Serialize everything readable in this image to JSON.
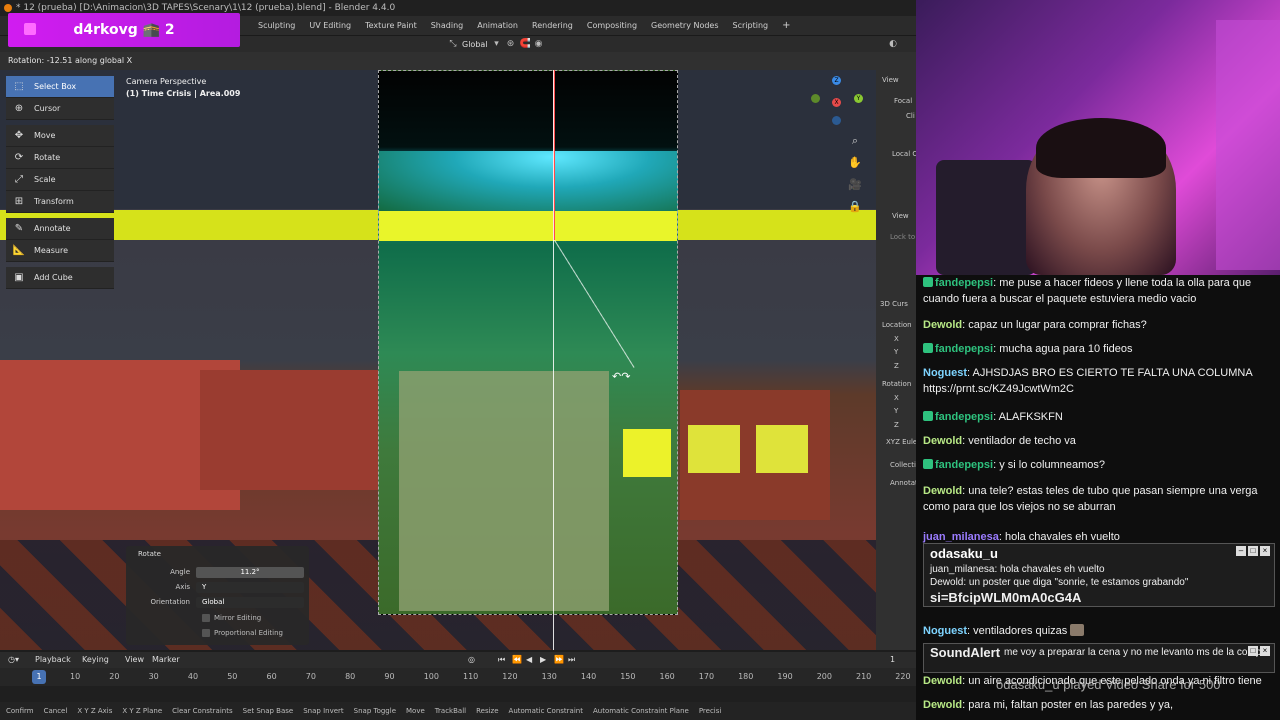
{
  "window": {
    "title": "* 12 (prueba) [D:\\Animacion\\3D TAPES\\Scenary\\1\\12 (prueba).blend] - Blender 4.4.0"
  },
  "overlay_tag": "d4rkovg 🕋 2",
  "workspaces": [
    "Sculpting",
    "UV Editing",
    "Texture Paint",
    "Shading",
    "Animation",
    "Rendering",
    "Compositing",
    "Geometry Nodes",
    "Scripting"
  ],
  "workspace_add": "+",
  "transform_orientation": "Global",
  "operator_status": "Rotation: -12.51 along global X",
  "viewport": {
    "perspective": "Camera Perspective",
    "collection": "(1) Time Crisis | Area.009"
  },
  "gizmo": {
    "z": "Z",
    "x": "X",
    "y": "Y"
  },
  "tools": [
    {
      "label": "Select Box",
      "active": true,
      "icon": "select-box-icon",
      "glyph": "⬚"
    },
    {
      "label": "Cursor",
      "active": false,
      "icon": "cursor-icon",
      "glyph": "⊕"
    },
    {
      "label": "Move",
      "active": false,
      "icon": "move-icon",
      "glyph": "✥"
    },
    {
      "label": "Rotate",
      "active": false,
      "icon": "rotate-icon",
      "glyph": "⟳"
    },
    {
      "label": "Scale",
      "active": false,
      "icon": "scale-icon",
      "glyph": "⤢"
    },
    {
      "label": "Transform",
      "active": false,
      "icon": "transform-icon",
      "glyph": "⊞"
    },
    {
      "label": "Annotate",
      "active": false,
      "icon": "annotate-icon",
      "glyph": "✎"
    },
    {
      "label": "Measure",
      "active": false,
      "icon": "measure-icon",
      "glyph": "📐"
    },
    {
      "label": "Add Cube",
      "active": false,
      "icon": "add-cube-icon",
      "glyph": "▣"
    }
  ],
  "rotate_panel": {
    "title": "Rotate",
    "angle_label": "Angle",
    "angle_value": "11.2°",
    "axis_label": "Axis",
    "axis_value": "Y",
    "orientation_label": "Orientation",
    "orientation_value": "Global",
    "mirror_editing": "Mirror Editing",
    "proportional_editing": "Proportional Editing"
  },
  "npanel": {
    "view": "View",
    "focal": "Focal",
    "clip": "Cli",
    "local_c": "Local C",
    "view2": "View",
    "lock_to": "Lock to",
    "cursor3d": "3D Curs",
    "location": "Location",
    "x": "X",
    "y": "Y",
    "z": "Z",
    "rotation": "Rotation",
    "xyz_euler": "XYZ Eule",
    "collection": "Collecti",
    "annotations": "Annotat"
  },
  "timeline": {
    "playback": "Playback",
    "keying": "Keying",
    "view": "View",
    "marker": "Marker",
    "current_frame": "1",
    "frame_marker": "10",
    "ticks": [
      "10",
      "20",
      "30",
      "40",
      "50",
      "60",
      "70",
      "80",
      "90",
      "100",
      "110",
      "120",
      "130",
      "140",
      "150",
      "160",
      "170",
      "180",
      "190",
      "200",
      "210",
      "220"
    ]
  },
  "statusbar": [
    "Confirm",
    "Cancel",
    "X Y Z Axis",
    "X Y Z Plane",
    "Clear Constraints",
    "Set Snap Base",
    "Snap Invert",
    "Snap Toggle",
    "Move",
    "TrackBall",
    "Resize",
    "Automatic Constraint",
    "Automatic Constraint Plane",
    "Precisi"
  ],
  "chat": {
    "messages": [
      {
        "user": "fandepepsi",
        "color": "#2ec27e",
        "badge": true,
        "text": "me puse a hacer fideos y llene toda la olla para que cuando fuera a buscar el paquete estuviera medio vacio"
      },
      {
        "user": "Dewold",
        "color": "#b8e986",
        "badge": false,
        "text": "capaz un lugar para comprar fichas?"
      },
      {
        "user": "fandepepsi",
        "color": "#2ec27e",
        "badge": true,
        "text": "mucha agua para 10 fideos"
      },
      {
        "user": "Noguest",
        "color": "#7ed4ff",
        "badge": false,
        "text": "AJHSDJAS BRO ES CIERTO TE FALTA UNA COLUMNA https://prnt.sc/KZ49JcwtWm2C"
      },
      {
        "user": "fandepepsi",
        "color": "#2ec27e",
        "badge": true,
        "text": "ALAFKSKFN"
      },
      {
        "user": "Dewold",
        "color": "#b8e986",
        "badge": false,
        "text": "ventilador de techo va"
      },
      {
        "user": "fandepepsi",
        "color": "#2ec27e",
        "badge": true,
        "text": "y si lo columneamos?"
      },
      {
        "user": "Dewold",
        "color": "#b8e986",
        "badge": false,
        "text": "una tele? estas teles de tubo que pasan siempre una verga como para que los viejos no se aburran"
      },
      {
        "user": "juan_milanesa",
        "color": "#9b7cff",
        "badge": false,
        "text": "hola chavales eh vuelto"
      }
    ],
    "popup_title": "odasaku_u",
    "popup_line1": "juan_milanesa: hola chavales eh vuelto",
    "popup_line2": "Dewold: un poster que diga \"sonrie, te estamos grabando\"",
    "popup_line3": "si=BfcipWLM0mA0cG4A",
    "noguest2": {
      "user": "Noguest",
      "color": "#7ed4ff",
      "text": "ventiladores quizas"
    },
    "popup2_title": "SoundAlert",
    "popup2_line": "me voy a preparar la cena y no me levanto ms de la compu",
    "dewold3": {
      "user": "Dewold",
      "color": "#b8e986",
      "text": "un aire acondicionado que este pelado onda ya ni filtro tiene"
    },
    "overlay_line": "odasaku_u played Video Share for 500",
    "dewold4": {
      "user": "Dewold",
      "color": "#b8e986",
      "text": "para mi, faltan poster en las paredes y ya,"
    }
  },
  "colors": {
    "accent": "#4772b3",
    "magenta": "#c41ee6",
    "highlight_yellow": "#d6e21a"
  }
}
